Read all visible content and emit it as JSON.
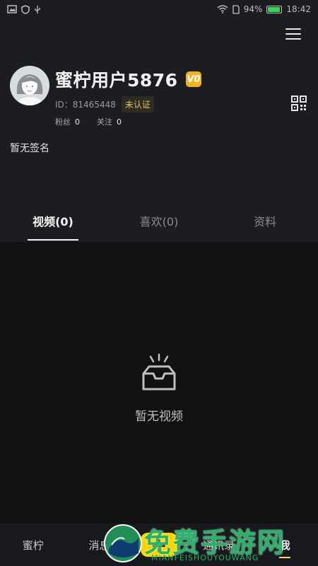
{
  "status_bar": {
    "battery": "94%",
    "time": "18:42"
  },
  "profile": {
    "username": "蜜柠用户5876",
    "vip_badge": "V0",
    "id_text": "ID：81465448",
    "verify_tag": "未认证",
    "fans_label": "粉丝",
    "fans_count": "0",
    "follow_label": "关注",
    "follow_count": "0",
    "signature": "暂无签名"
  },
  "tabs": [
    {
      "label": "视频(0)",
      "active": true
    },
    {
      "label": "喜欢(0)",
      "active": false
    },
    {
      "label": "资料",
      "active": false
    }
  ],
  "empty_state": {
    "text": "暂无视频"
  },
  "bottom_nav": [
    {
      "label": "蜜柠"
    },
    {
      "label": "消息"
    },
    {
      "label": "+"
    },
    {
      "label": "通讯录"
    },
    {
      "label": "我",
      "active": true
    }
  ],
  "watermark": {
    "title": "免费手游网",
    "subtitle": "MIANFEISHOUYOUWANG"
  },
  "colors": {
    "accent": "#ffd400",
    "verify": "#e0c15b",
    "vip": "#f2b321",
    "watermark": "#25b36a"
  }
}
